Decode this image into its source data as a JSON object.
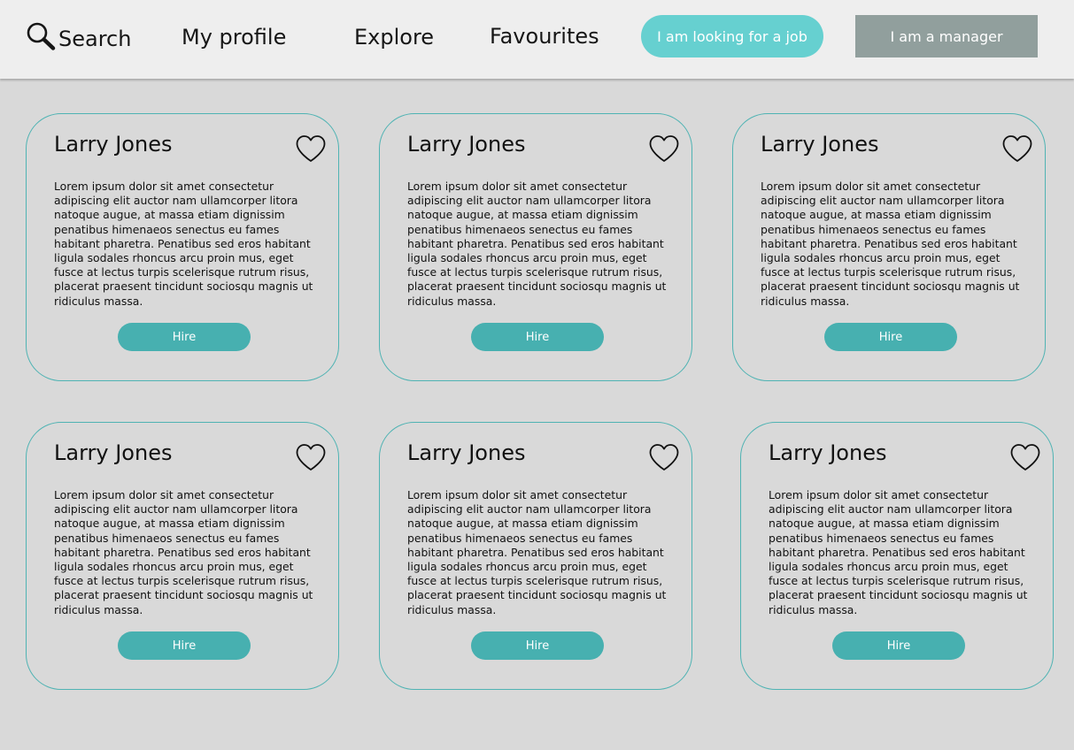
{
  "nav": {
    "search_label": "Search",
    "profile_label": "My profile",
    "explore_label": "Explore",
    "favourites_label": "Favourites",
    "job_button_label": "I am looking for a job",
    "manager_button_label": "I am a manager"
  },
  "colors": {
    "background": "#d9d9d9",
    "topbar": "#eeeeee",
    "accent": "#47b0b0",
    "job_button": "#66d0d0",
    "manager_button": "#919f9d",
    "card_border": "#4fb3b3"
  },
  "cards": [
    {
      "name": "Larry Jones",
      "description": "Lorem ipsum dolor sit amet consectetur adipiscing elit auctor nam ullamcorper litora natoque augue, at massa etiam dignissim penatibus himenaeos senectus eu fames habitant pharetra. Penatibus sed eros habitant ligula sodales rhoncus arcu proin mus, eget fusce at lectus turpis scelerisque rutrum risus, placerat praesent tincidunt sociosqu magnis ut ridiculus massa.",
      "hire_label": "Hire",
      "favourite_icon": "heart-outline-icon"
    },
    {
      "name": "Larry Jones",
      "description": "Lorem ipsum dolor sit amet consectetur adipiscing elit auctor nam ullamcorper litora natoque augue, at massa etiam dignissim penatibus himenaeos senectus eu fames habitant pharetra. Penatibus sed eros habitant ligula sodales rhoncus arcu proin mus, eget fusce at lectus turpis scelerisque rutrum risus, placerat praesent tincidunt sociosqu magnis ut ridiculus massa.",
      "hire_label": "Hire",
      "favourite_icon": "heart-outline-icon"
    },
    {
      "name": "Larry Jones",
      "description": "Lorem ipsum dolor sit amet consectetur adipiscing elit auctor nam ullamcorper litora natoque augue, at massa etiam dignissim penatibus himenaeos senectus eu fames habitant pharetra. Penatibus sed eros habitant ligula sodales rhoncus arcu proin mus, eget fusce at lectus turpis scelerisque rutrum risus, placerat praesent tincidunt sociosqu magnis ut ridiculus massa.",
      "hire_label": "Hire",
      "favourite_icon": "heart-outline-icon"
    },
    {
      "name": "Larry Jones",
      "description": "Lorem ipsum dolor sit amet consectetur adipiscing elit auctor nam ullamcorper litora natoque augue, at massa etiam dignissim penatibus himenaeos senectus eu fames habitant pharetra. Penatibus sed eros habitant ligula sodales rhoncus arcu proin mus, eget fusce at lectus turpis scelerisque rutrum risus, placerat praesent tincidunt sociosqu magnis ut ridiculus massa.",
      "hire_label": "Hire",
      "favourite_icon": "heart-outline-icon"
    },
    {
      "name": "Larry Jones",
      "description": "Lorem ipsum dolor sit amet consectetur adipiscing elit auctor nam ullamcorper litora natoque augue, at massa etiam dignissim penatibus himenaeos senectus eu fames habitant pharetra. Penatibus sed eros habitant ligula sodales rhoncus arcu proin mus, eget fusce at lectus turpis scelerisque rutrum risus, placerat praesent tincidunt sociosqu magnis ut ridiculus massa.",
      "hire_label": "Hire",
      "favourite_icon": "heart-outline-icon"
    },
    {
      "name": "Larry Jones",
      "description": "Lorem ipsum dolor sit amet consectetur adipiscing elit auctor nam ullamcorper litora natoque augue, at massa etiam dignissim penatibus himenaeos senectus eu fames habitant pharetra. Penatibus sed eros habitant ligula sodales rhoncus arcu proin mus, eget fusce at lectus turpis scelerisque rutrum risus, placerat praesent tincidunt sociosqu magnis ut ridiculus massa.",
      "hire_label": "Hire",
      "favourite_icon": "heart-outline-icon"
    }
  ]
}
